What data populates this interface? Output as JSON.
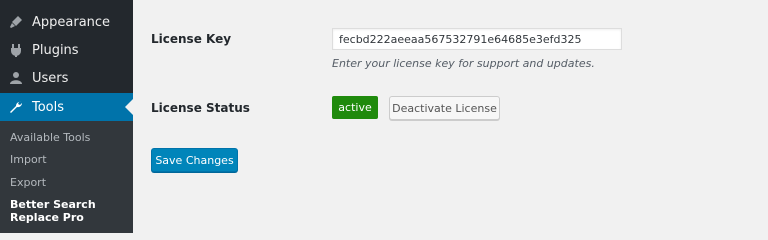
{
  "colors": {
    "sidebar_bg": "#23282d",
    "submenu_bg": "#32373c",
    "accent": "#0073aa",
    "primary_button": "#0085ba",
    "status_active": "#1f8a0c",
    "page_bg": "#f1f1f1"
  },
  "sidebar": {
    "items": [
      {
        "label": "Appearance",
        "icon": "paintbrush-icon"
      },
      {
        "label": "Plugins",
        "icon": "plugin-icon"
      },
      {
        "label": "Users",
        "icon": "user-icon"
      },
      {
        "label": "Tools",
        "icon": "wrench-icon",
        "current": true
      }
    ],
    "submenu": [
      {
        "label": "Available Tools"
      },
      {
        "label": "Import"
      },
      {
        "label": "Export"
      },
      {
        "label": "Better Search Replace Pro",
        "current": true
      }
    ]
  },
  "form": {
    "license_key": {
      "label": "License Key",
      "value": "fecbd222aeeaa567532791e64685e3efd325",
      "description": "Enter your license key for support and updates."
    },
    "license_status": {
      "label": "License Status",
      "status": "active",
      "deactivate_label": "Deactivate License"
    },
    "save_label": "Save Changes"
  }
}
